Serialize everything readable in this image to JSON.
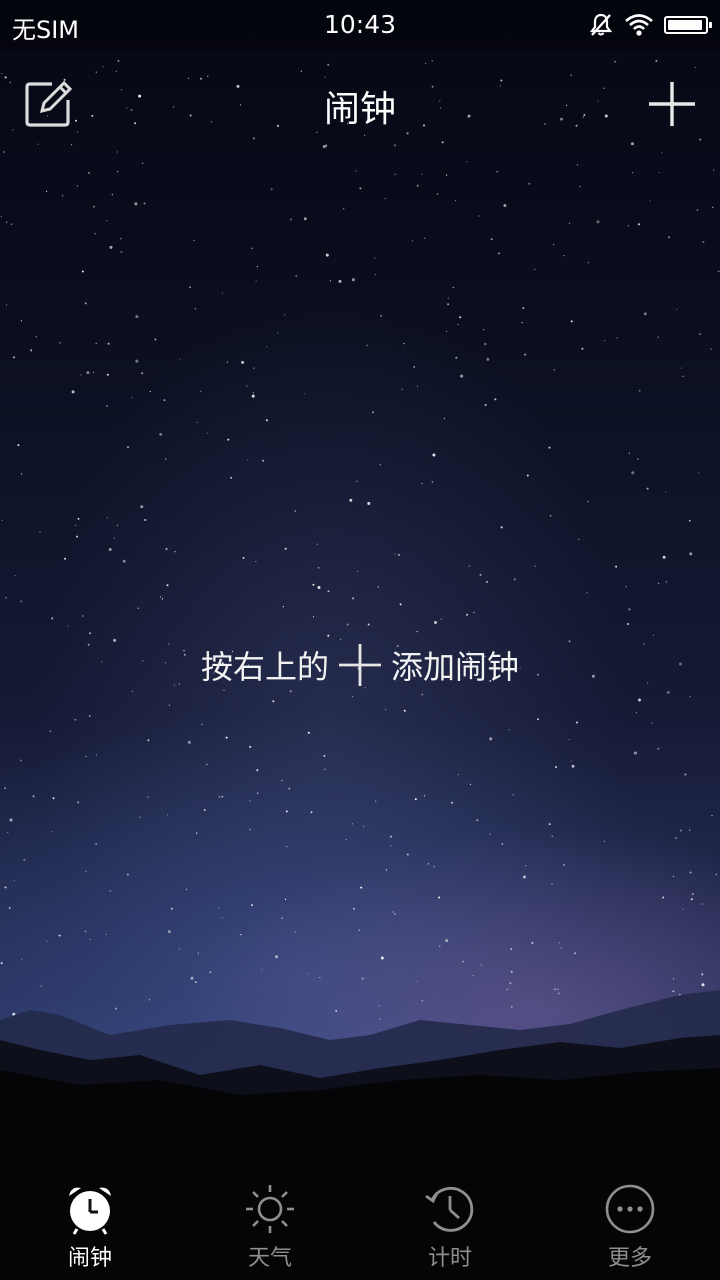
{
  "status_bar": {
    "carrier": "无SIM",
    "time": "10:43",
    "battery_level": 0.95
  },
  "header": {
    "title": "闹钟"
  },
  "empty_state": {
    "hint_before": "按右上的",
    "hint_after": "添加闹钟"
  },
  "bottom_nav": {
    "items": [
      {
        "label": "闹钟",
        "icon": "alarm-clock-icon",
        "active": true
      },
      {
        "label": "天气",
        "icon": "sun-icon",
        "active": false
      },
      {
        "label": "计时",
        "icon": "timer-icon",
        "active": false
      },
      {
        "label": "更多",
        "icon": "more-icon",
        "active": false
      }
    ]
  },
  "colors": {
    "active_label": "#ffffff",
    "inactive_label": "#8f8f8f",
    "background": "#0a0e1f"
  }
}
